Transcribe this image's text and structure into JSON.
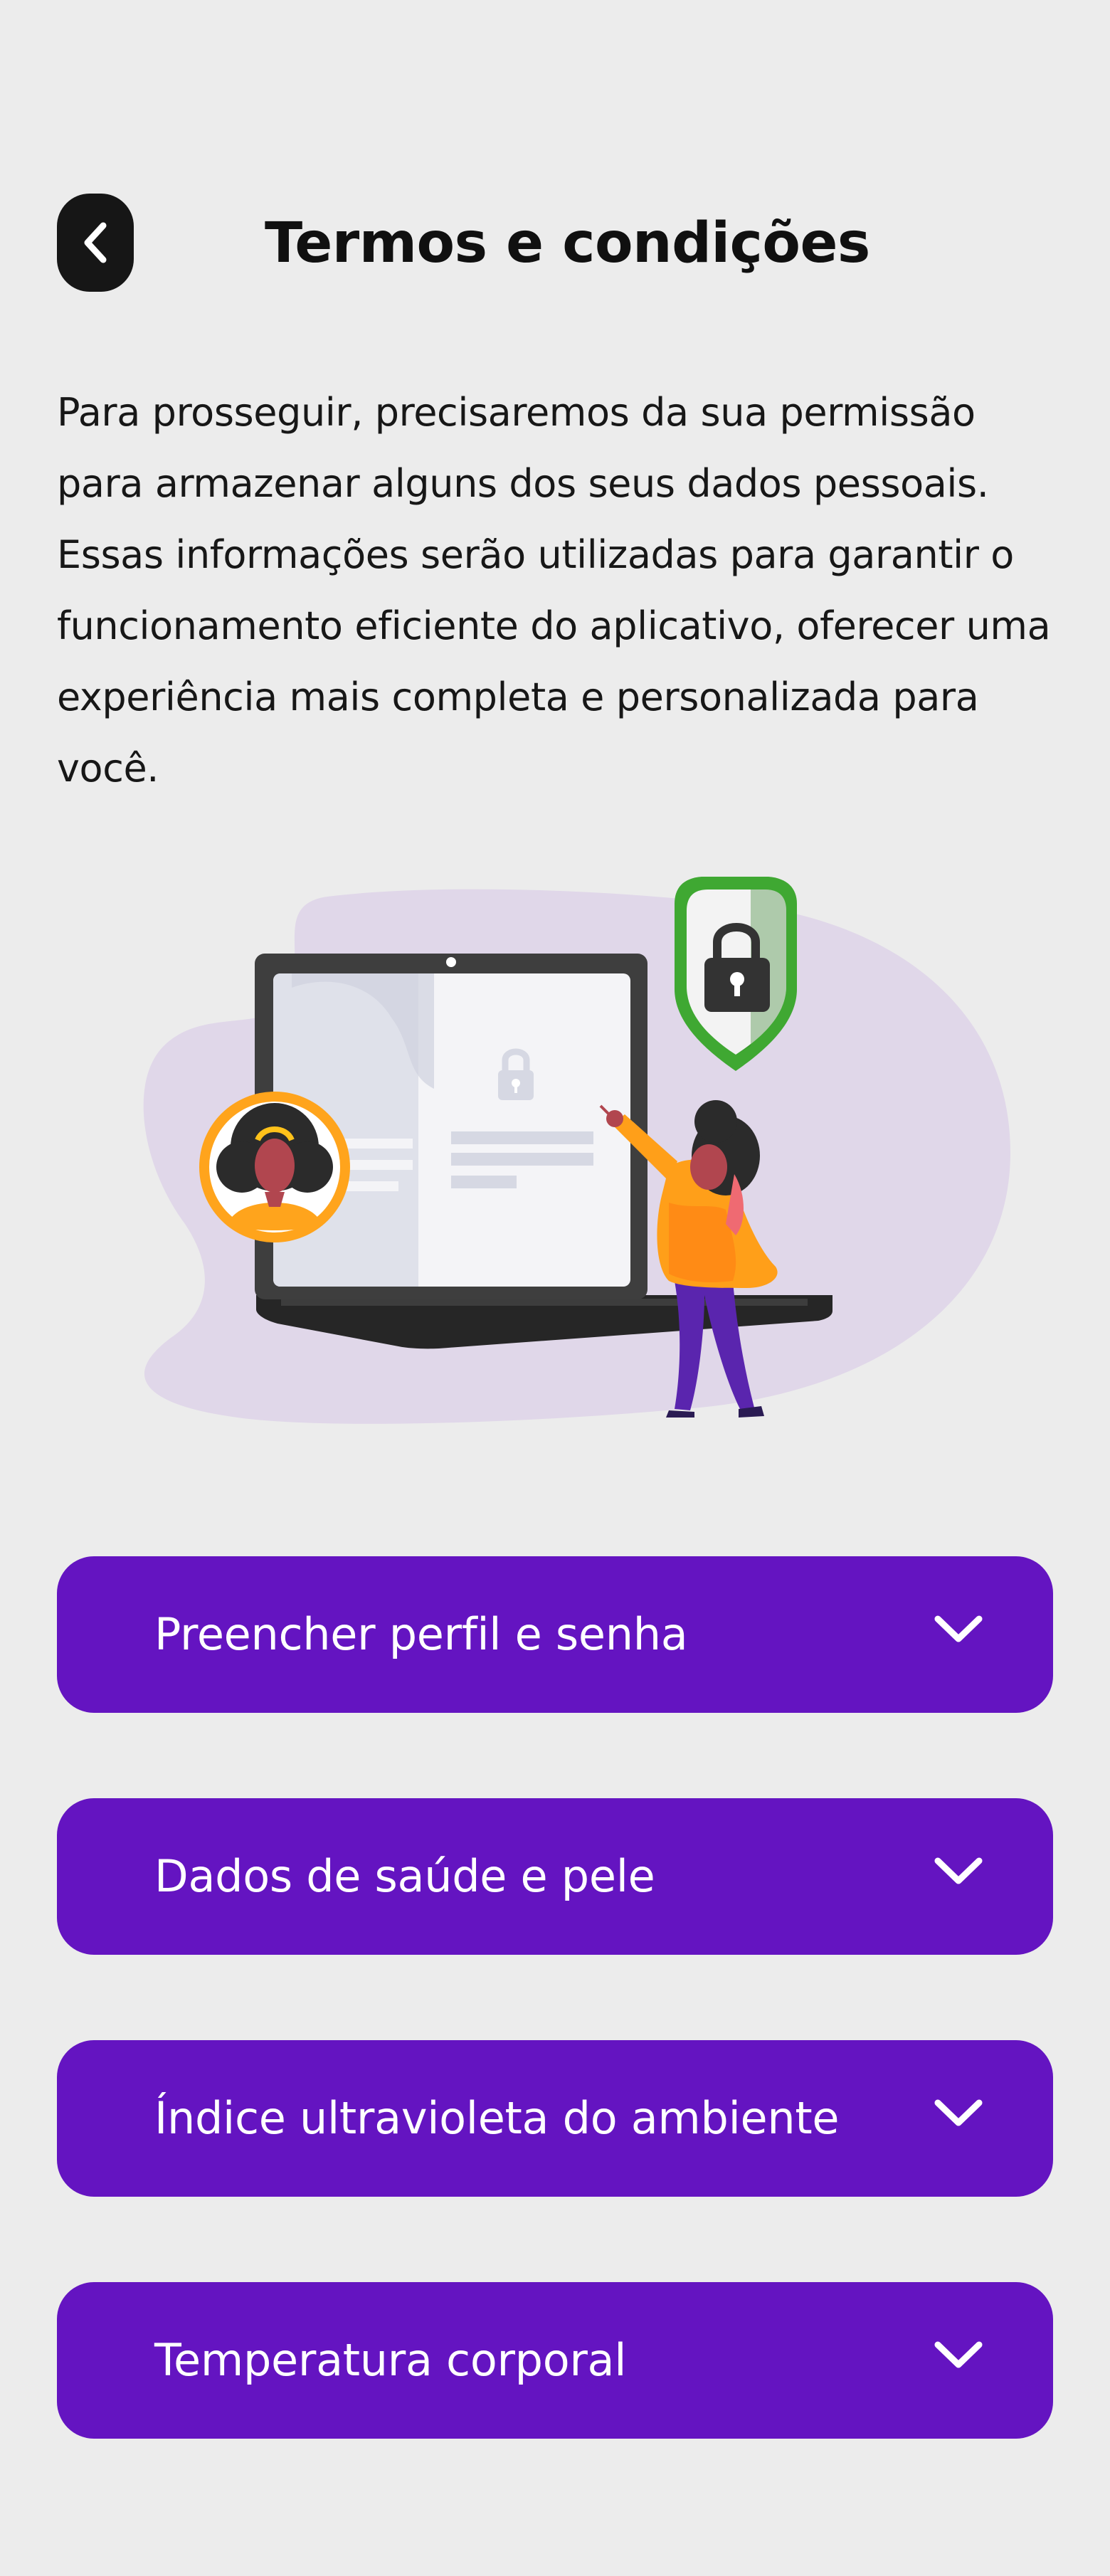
{
  "header": {
    "title": "Termos e condições"
  },
  "intro": {
    "text": "Para prosseguir, precisaremos da sua permissão para armazenar alguns dos seus dados pessoais. Essas informações serão utilizadas para garantir o funcionamento eficiente do aplicativo, oferecer uma experiência mais completa e personalizada para você."
  },
  "sections": [
    {
      "label": "Preencher perfil e senha"
    },
    {
      "label": "Dados de saúde e pele"
    },
    {
      "label": "Índice ultravioleta do ambiente"
    },
    {
      "label": "Temperatura corporal"
    }
  ],
  "colors": {
    "background": "#ececec",
    "accent": "#6414c1",
    "back_button": "#161616",
    "shield": "#3fa832"
  }
}
